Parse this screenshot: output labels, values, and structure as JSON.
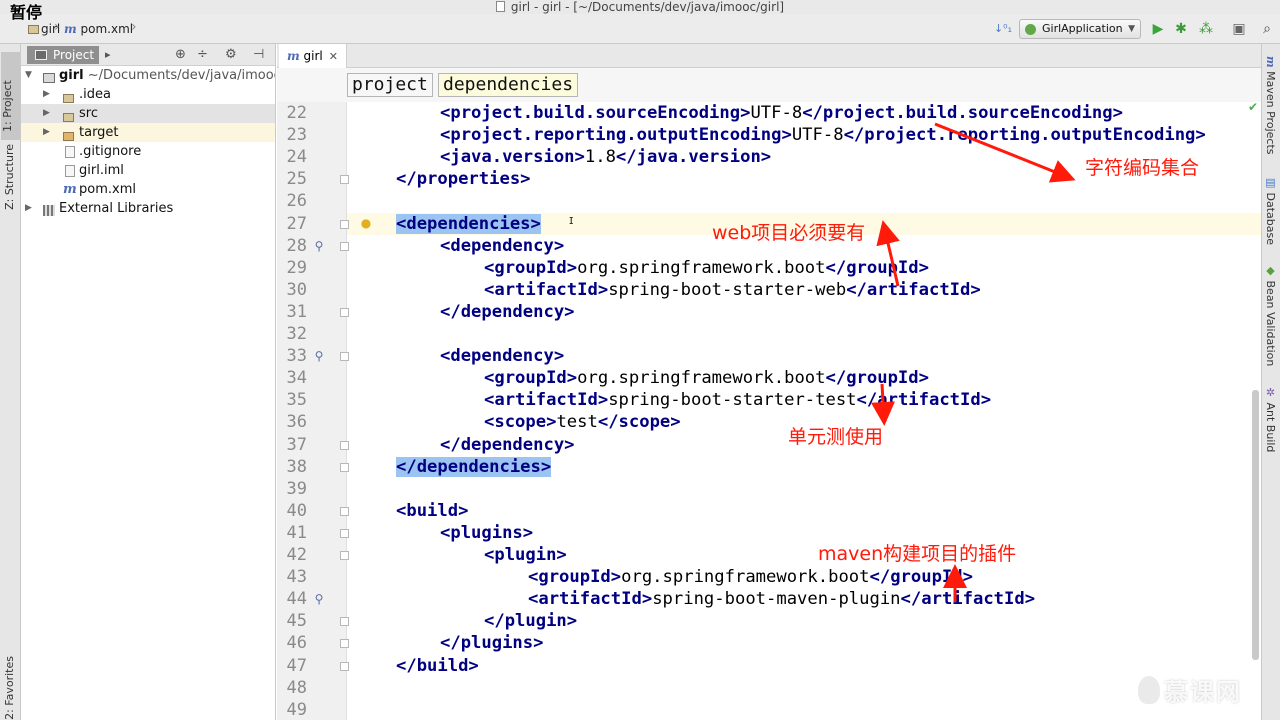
{
  "overlay": {
    "pause_label": "暂停"
  },
  "window": {
    "title": "girl - girl - [~/Documents/dev/java/imooc/girl]"
  },
  "navbar": {
    "crumbs": [
      "girl",
      "pom.xml"
    ],
    "run_config": "GirlApplication"
  },
  "left_strip": {
    "tabs": [
      "1: Project",
      "Z: Structure",
      "2: Favorites"
    ]
  },
  "project_panel": {
    "tab_label": "Project",
    "tree": [
      {
        "label": "girl",
        "suffix": "~/Documents/dev/java/imooc/girl",
        "icon": "module-icon"
      },
      {
        "label": ".idea",
        "icon": "folder-icon"
      },
      {
        "label": "src",
        "icon": "folder-icon"
      },
      {
        "label": "target",
        "icon": "folder-icon"
      },
      {
        "label": ".gitignore",
        "icon": "file-icon"
      },
      {
        "label": "girl.iml",
        "icon": "file-icon"
      },
      {
        "label": "pom.xml",
        "icon": "maven-icon"
      },
      {
        "label": "External Libraries",
        "icon": "library-icon"
      }
    ]
  },
  "editor": {
    "tab_label": "girl",
    "breadcrumbs": [
      "project",
      "dependencies"
    ],
    "line_numbers": [
      "22",
      "23",
      "24",
      "25",
      "26",
      "27",
      "28",
      "29",
      "30",
      "31",
      "32",
      "33",
      "34",
      "35",
      "36",
      "37",
      "38",
      "39",
      "40",
      "41",
      "42",
      "43",
      "44",
      "45",
      "46",
      "47",
      "48",
      "49"
    ],
    "lines": [
      {
        "indent": 2,
        "parts": [
          [
            "t",
            "<project.build.sourceEncoding>"
          ],
          [
            "x",
            "UTF-8"
          ],
          [
            "t",
            "</project.build.sourceEncoding>"
          ]
        ]
      },
      {
        "indent": 2,
        "parts": [
          [
            "t",
            "<project.reporting.outputEncoding>"
          ],
          [
            "x",
            "UTF-8"
          ],
          [
            "t",
            "</project.reporting.outputEncoding>"
          ]
        ]
      },
      {
        "indent": 2,
        "parts": [
          [
            "t",
            "<java.version>"
          ],
          [
            "x",
            "1.8"
          ],
          [
            "t",
            "</java.version>"
          ]
        ]
      },
      {
        "indent": 1,
        "parts": [
          [
            "t",
            "</properties>"
          ]
        ]
      },
      {
        "indent": 0,
        "parts": []
      },
      {
        "indent": 1,
        "parts": [
          [
            "h",
            "<dependencies>"
          ]
        ]
      },
      {
        "indent": 2,
        "parts": [
          [
            "t",
            "<dependency>"
          ]
        ]
      },
      {
        "indent": 3,
        "parts": [
          [
            "t",
            "<groupId>"
          ],
          [
            "x",
            "org.springframework.boot"
          ],
          [
            "t",
            "</groupId>"
          ]
        ]
      },
      {
        "indent": 3,
        "parts": [
          [
            "t",
            "<artifactId>"
          ],
          [
            "x",
            "spring-boot-starter-web"
          ],
          [
            "t",
            "</artifactId>"
          ]
        ]
      },
      {
        "indent": 2,
        "parts": [
          [
            "t",
            "</dependency>"
          ]
        ]
      },
      {
        "indent": 0,
        "parts": []
      },
      {
        "indent": 2,
        "parts": [
          [
            "t",
            "<dependency>"
          ]
        ]
      },
      {
        "indent": 3,
        "parts": [
          [
            "t",
            "<groupId>"
          ],
          [
            "x",
            "org.springframework.boot"
          ],
          [
            "t",
            "</groupId>"
          ]
        ]
      },
      {
        "indent": 3,
        "parts": [
          [
            "t",
            "<artifactId>"
          ],
          [
            "x",
            "spring-boot-starter-test"
          ],
          [
            "t",
            "</artifactId>"
          ]
        ]
      },
      {
        "indent": 3,
        "parts": [
          [
            "t",
            "<scope>"
          ],
          [
            "x",
            "test"
          ],
          [
            "t",
            "</scope>"
          ]
        ]
      },
      {
        "indent": 2,
        "parts": [
          [
            "t",
            "</dependency>"
          ]
        ]
      },
      {
        "indent": 1,
        "parts": [
          [
            "h",
            "</dependencies>"
          ]
        ]
      },
      {
        "indent": 0,
        "parts": []
      },
      {
        "indent": 1,
        "parts": [
          [
            "t",
            "<build>"
          ]
        ]
      },
      {
        "indent": 2,
        "parts": [
          [
            "t",
            "<plugins>"
          ]
        ]
      },
      {
        "indent": 3,
        "parts": [
          [
            "t",
            "<plugin>"
          ]
        ]
      },
      {
        "indent": 4,
        "parts": [
          [
            "t",
            "<groupId>"
          ],
          [
            "x",
            "org.springframework.boot"
          ],
          [
            "t",
            "</groupId>"
          ]
        ]
      },
      {
        "indent": 4,
        "parts": [
          [
            "t",
            "<artifactId>"
          ],
          [
            "x",
            "spring-boot-maven-plugin"
          ],
          [
            "t",
            "</artifactId>"
          ]
        ]
      },
      {
        "indent": 3,
        "parts": [
          [
            "t",
            "</plugin>"
          ]
        ]
      },
      {
        "indent": 2,
        "parts": [
          [
            "t",
            "</plugins>"
          ]
        ]
      },
      {
        "indent": 1,
        "parts": [
          [
            "t",
            "</build>"
          ]
        ]
      },
      {
        "indent": 0,
        "parts": []
      },
      {
        "indent": 0,
        "parts": []
      }
    ]
  },
  "right_strip": {
    "tabs": [
      "Maven Projects",
      "Database",
      "Bean Validation",
      "Ant Build"
    ]
  },
  "annotations": {
    "encoding": "字符编码集合",
    "web": "web项目必须要有",
    "test": "单元测使用",
    "maven": "maven构建项目的插件"
  },
  "watermark": "慕课网",
  "colors": {
    "tag": "#000080",
    "annotation": "#ff1a0a",
    "highlight_tag": "#9cc4f2",
    "current_line": "#fffae3"
  }
}
